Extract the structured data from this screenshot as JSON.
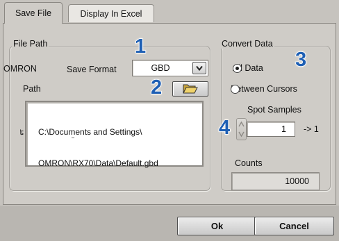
{
  "tabs": [
    {
      "label": "Save File",
      "active": true
    },
    {
      "label": "Display In Excel",
      "active": false
    }
  ],
  "file_path": {
    "group_title": "File Path",
    "device_label": "OMRON",
    "save_format_label": "Save Format",
    "save_format_value": "GBD",
    "path_label": "Path",
    "path_lines": [
      "C:\\Documents and Settings\\",
      "OMRON\\RX70\\Data\\Default.gbd"
    ],
    "path_small_mark": "ʨ"
  },
  "convert_data": {
    "group_title": "Convert Data",
    "all_data_label": "All Data",
    "all_data_selected": true,
    "between_cursors_label": "Between Cursors",
    "between_cursors_selected": false,
    "spot_samples_label": "Spot Samples",
    "spot_samples_value": "1",
    "spot_samples_suffix": "-> 1",
    "counts_label": "Counts",
    "counts_value": "10000"
  },
  "buttons": {
    "ok_label": "Ok",
    "cancel_label": "Cancel"
  },
  "callouts": [
    "1",
    "2",
    "3",
    "4"
  ],
  "colors": {
    "callout": "#1e5fb4",
    "panel": "#cfccc7",
    "footer": "#b9b6b1"
  },
  "icons": {
    "folder": "folder-open-icon",
    "dropdown": "chevron-down-icon",
    "spinner": "spinner-arrows-icon"
  }
}
